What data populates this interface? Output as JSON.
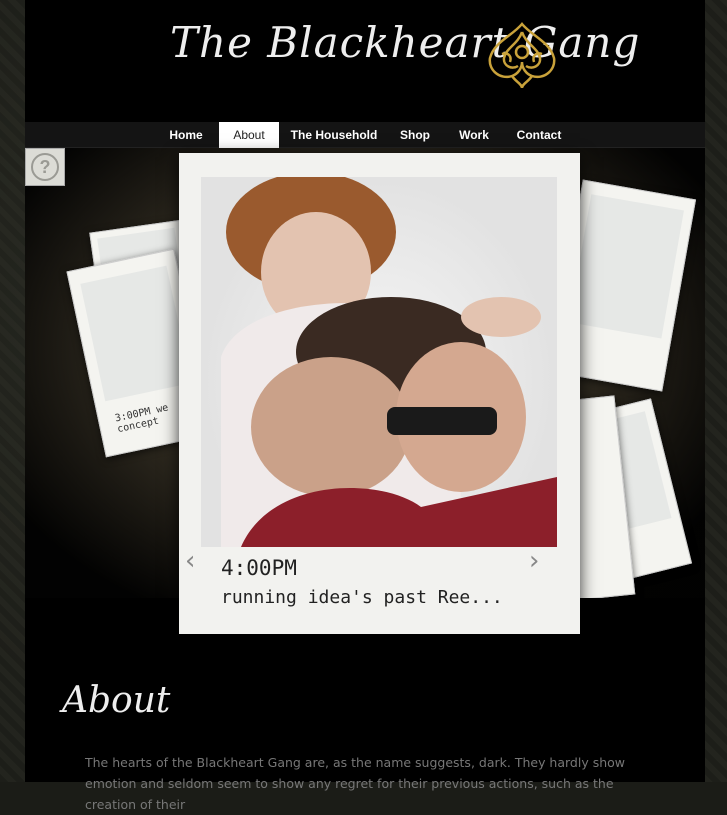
{
  "header": {
    "logo_text": "The Blackheart Gang",
    "emblem_icon": "ornate-heart-emblem-icon"
  },
  "nav": {
    "items": [
      {
        "label": "Home",
        "active": false
      },
      {
        "label": "About",
        "active": true
      },
      {
        "label": "The Household",
        "active": false
      },
      {
        "label": "Shop",
        "active": false
      },
      {
        "label": "Work",
        "active": false
      },
      {
        "label": "Contact",
        "active": false
      }
    ]
  },
  "gallery": {
    "help_icon": "question-mark-icon",
    "prev_icon": "chevron-left-icon",
    "next_icon": "chevron-right-icon",
    "caption_time": "4:00PM",
    "caption_text": "running idea's past Ree...",
    "left_polaroid_note": "3:00PM we concept"
  },
  "about": {
    "heading": "About",
    "body": "The hearts of the Blackheart Gang are, as the name suggests, dark. They hardly show emotion and seldom seem to show any regret for their previous actions, such as the creation of their"
  },
  "colors": {
    "background": "#1b1c17",
    "page": "#000000",
    "nav_bar": "#141414",
    "nav_active_bg": "#ffffff",
    "about_text": "#777777",
    "emblem_gold": "#c9a23a"
  }
}
